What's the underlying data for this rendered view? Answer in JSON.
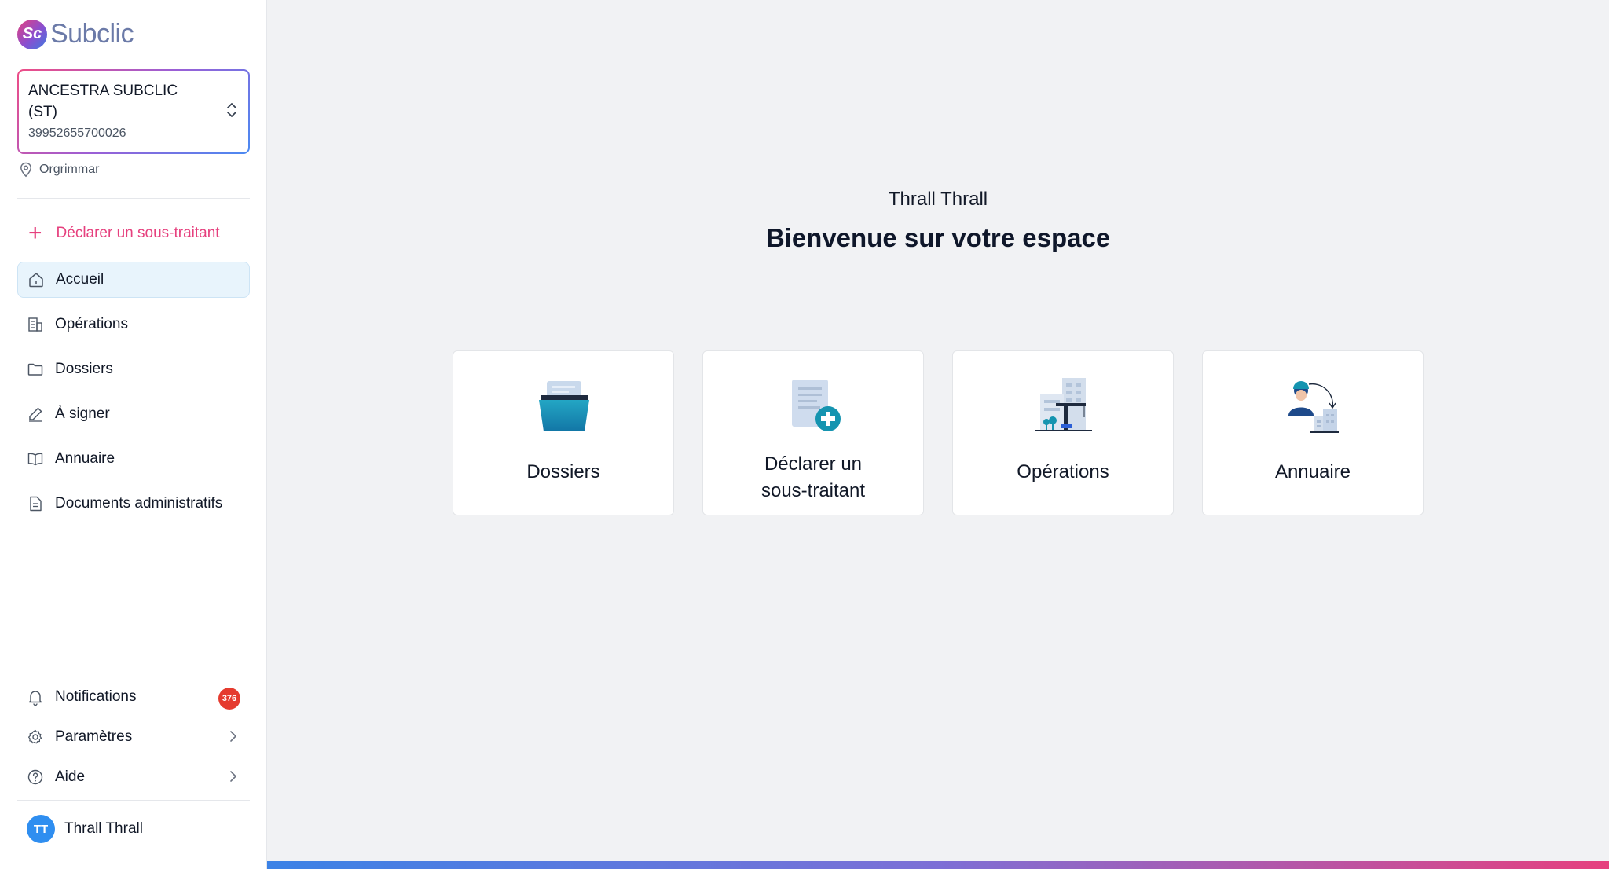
{
  "brand": {
    "name_part1": "Sub",
    "name_part2": "clic",
    "mark": "Sc"
  },
  "company": {
    "name": "ANCESTRA SUBCLIC (ST)",
    "siret": "39952655700026",
    "location": "Orgrimmar"
  },
  "sidebar": {
    "declare_label": "Déclarer un sous-traitant",
    "items": [
      {
        "label": "Accueil",
        "icon": "home-icon"
      },
      {
        "label": "Opérations",
        "icon": "building-icon"
      },
      {
        "label": "Dossiers",
        "icon": "folder-icon"
      },
      {
        "label": "À signer",
        "icon": "pen-icon"
      },
      {
        "label": "Annuaire",
        "icon": "book-icon"
      },
      {
        "label": "Documents administratifs",
        "icon": "document-icon"
      }
    ],
    "bottom": {
      "notifications_label": "Notifications",
      "notifications_count": "376",
      "settings_label": "Paramètres",
      "help_label": "Aide"
    }
  },
  "user": {
    "initials": "TT",
    "name": "Thrall Thrall"
  },
  "main": {
    "user_name": "Thrall Thrall",
    "welcome": "Bienvenue sur votre espace",
    "cards": [
      {
        "label": "Dossiers",
        "icon": "folder-illustration"
      },
      {
        "label_line1": "Déclarer un",
        "label_line2": "sous-traitant",
        "icon": "add-document-illustration"
      },
      {
        "label": "Opérations",
        "icon": "construction-illustration"
      },
      {
        "label": "Annuaire",
        "icon": "directory-illustration"
      }
    ]
  },
  "colors": {
    "accent": "#e6407e",
    "active_bg": "#e8f4fc",
    "badge": "#e53b2f",
    "avatar": "#2f8ef0"
  }
}
